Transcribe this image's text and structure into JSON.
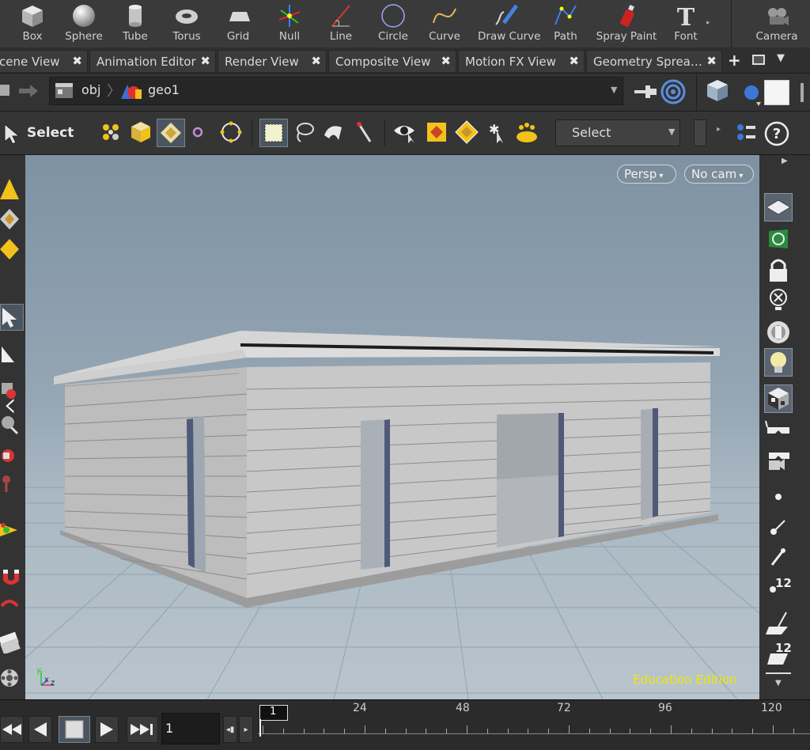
{
  "shelf": {
    "tools": [
      {
        "label": "Box",
        "icon": "box-icon"
      },
      {
        "label": "Sphere",
        "icon": "sphere-icon"
      },
      {
        "label": "Tube",
        "icon": "tube-icon"
      },
      {
        "label": "Torus",
        "icon": "torus-icon"
      },
      {
        "label": "Grid",
        "icon": "grid-icon"
      },
      {
        "label": "Null",
        "icon": "null-icon"
      },
      {
        "label": "Line",
        "icon": "line-icon"
      },
      {
        "label": "Circle",
        "icon": "circle-icon"
      },
      {
        "label": "Curve",
        "icon": "curve-icon"
      },
      {
        "label": "Draw Curve",
        "icon": "draw-curve-icon"
      },
      {
        "label": "Path",
        "icon": "path-icon"
      },
      {
        "label": "Spray Paint",
        "icon": "spray-paint-icon"
      },
      {
        "label": "Font",
        "icon": "font-icon"
      }
    ],
    "camera_label": "Camera"
  },
  "tabs": [
    {
      "label": "cene View"
    },
    {
      "label": "Animation Editor"
    },
    {
      "label": "Render View"
    },
    {
      "label": "Composite View"
    },
    {
      "label": "Motion FX View"
    },
    {
      "label": "Geometry Sprea…"
    }
  ],
  "tab_close": "✖",
  "path": {
    "root": "obj",
    "node": "geo1"
  },
  "toolbar": {
    "select_label": "Select",
    "select_dropdown": "Select"
  },
  "viewport": {
    "persp": "Persp",
    "cam": "No cam",
    "watermark": "Education Edition",
    "axis_y": "y",
    "axis_x": "x",
    "axis_z": "z"
  },
  "right_tool": {
    "badge_a": "12",
    "badge_b": "12"
  },
  "timeline": {
    "frame": "1",
    "marker": "1",
    "ticks": [
      "24",
      "48",
      "72",
      "96",
      "120"
    ]
  },
  "colors": {
    "accent": "#f2e600",
    "viewport_top": "#7e92a3",
    "viewport_bottom": "#b9c5cd"
  }
}
